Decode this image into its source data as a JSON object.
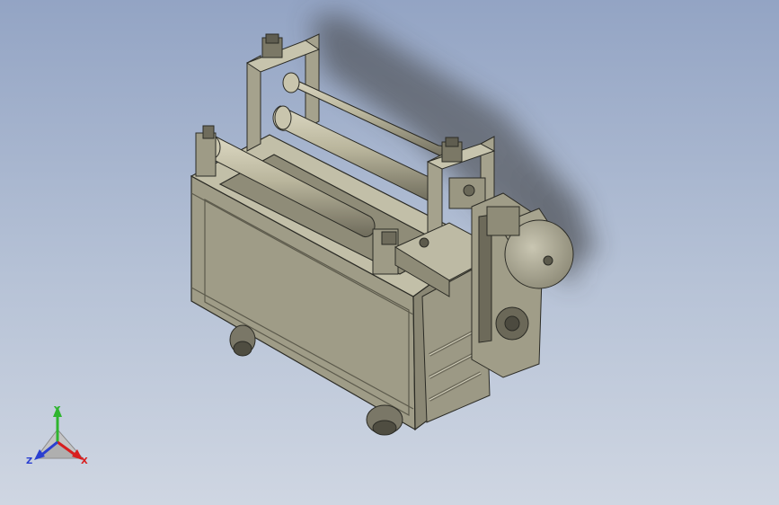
{
  "triad": {
    "x_label": "X",
    "y_label": "Y",
    "z_label": "Z",
    "x_color": "#d81e1e",
    "y_color": "#2fb52f",
    "z_color": "#2a3fd1"
  },
  "colors": {
    "background_top": "#93a4c4",
    "background_bottom": "#cfd6e2",
    "body": "#a7a48f",
    "roller": "#b8b49b",
    "edge": "#2b2b25"
  }
}
